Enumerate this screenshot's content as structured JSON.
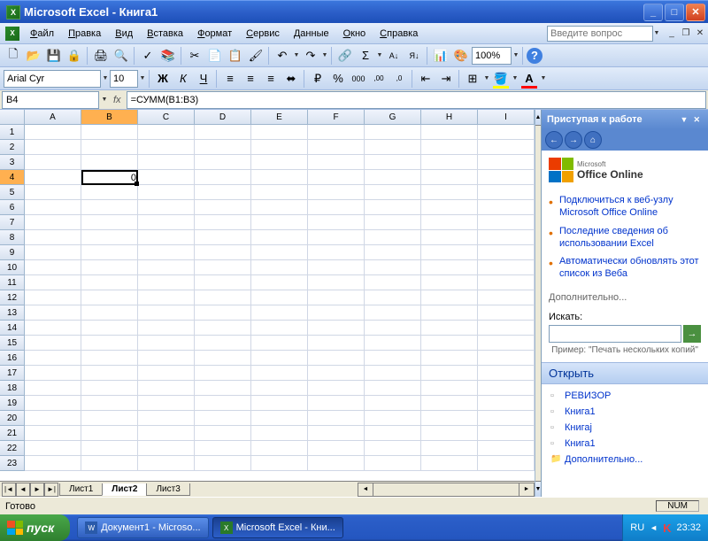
{
  "window": {
    "title": "Microsoft Excel - Книга1"
  },
  "menu": {
    "items": [
      "Файл",
      "Правка",
      "Вид",
      "Вставка",
      "Формат",
      "Сервис",
      "Данные",
      "Окно",
      "Справка"
    ],
    "ask_placeholder": "Введите вопрос"
  },
  "format": {
    "font_name": "Arial Cyr",
    "font_size": "10",
    "zoom": "100%"
  },
  "formula": {
    "cell_ref": "B4",
    "fx": "fx",
    "content": "=СУММ(B1:B3)"
  },
  "grid": {
    "cols": [
      "A",
      "B",
      "C",
      "D",
      "E",
      "F",
      "G",
      "H",
      "I"
    ],
    "rows": [
      "1",
      "2",
      "3",
      "4",
      "5",
      "6",
      "7",
      "8",
      "9",
      "10",
      "11",
      "12",
      "13",
      "14",
      "15",
      "16",
      "17",
      "18",
      "19",
      "20",
      "21",
      "22",
      "23"
    ],
    "selected": {
      "row": 4,
      "col": "B",
      "value": "0"
    }
  },
  "sheets": {
    "tabs": [
      "Лист1",
      "Лист2",
      "Лист3"
    ],
    "active": 1
  },
  "taskpane": {
    "title": "Приступая к работе",
    "office_small": "Microsoft",
    "office_big": "Office Online",
    "bullets": [
      "Подключиться к веб-узлу Microsoft Office Online",
      "Последние сведения об использовании Excel",
      "Автоматически обновлять этот список из Веба"
    ],
    "more": "Дополнительно...",
    "search_label": "Искать:",
    "example": "Пример: \"Печать нескольких копий\"",
    "open_header": "Открыть",
    "files": [
      "РЕВИЗОР",
      "Книга1",
      "Книгаj",
      "Книга1"
    ],
    "open_more": "Дополнительно..."
  },
  "status": {
    "ready": "Готово",
    "num": "NUM"
  },
  "taskbar": {
    "start": "пуск",
    "apps": [
      {
        "label": "Документ1 - Microso...",
        "type": "w"
      },
      {
        "label": "Microsoft Excel - Кни...",
        "type": "x"
      }
    ],
    "lang": "RU",
    "time": "23:32"
  }
}
